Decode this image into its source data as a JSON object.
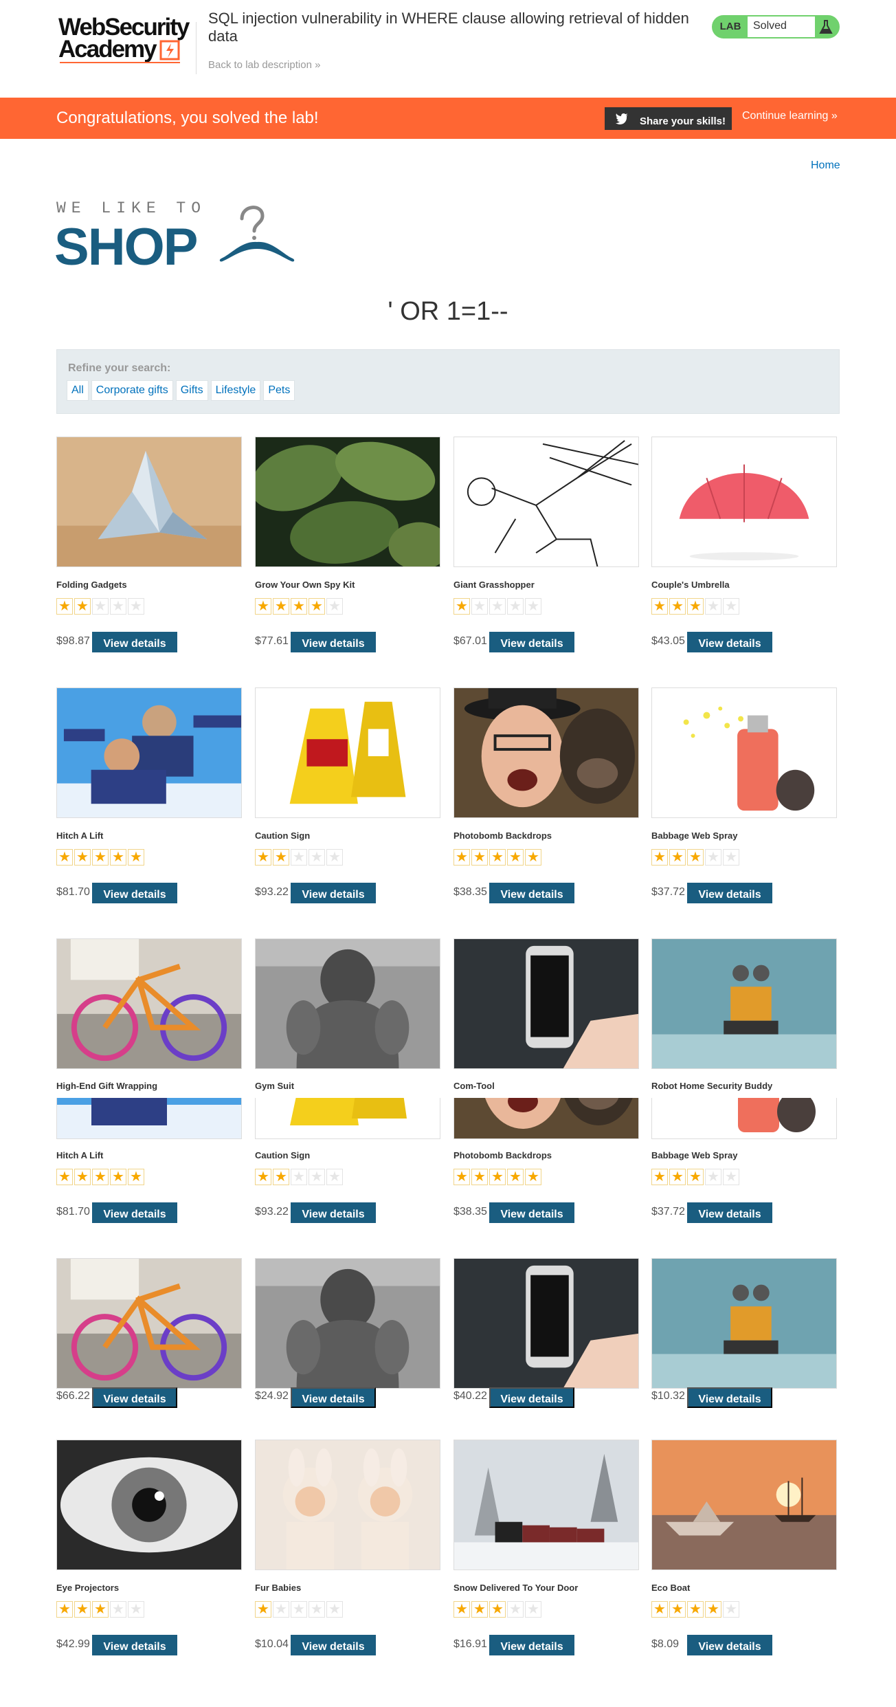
{
  "header": {
    "logo_line1": "WebSecurity",
    "logo_line2": "Academy",
    "lab_title": "SQL injection vulnerability in WHERE clause allowing retrieval of hidden data",
    "back_link": "Back to lab description  »",
    "status_label": "LAB",
    "status_value": "Solved"
  },
  "banner": {
    "message": "Congratulations, you solved the lab!",
    "share_label": "Share your skills!",
    "continue_label": "Continue learning »"
  },
  "nav": {
    "home": "Home"
  },
  "shop_logo": {
    "tagline": "WE LIKE TO",
    "word": "SHOP"
  },
  "search_title": "' OR 1=1--",
  "filter": {
    "label": "Refine your search:",
    "categories": [
      "All",
      "Corporate gifts",
      "Gifts",
      "Lifestyle",
      "Pets"
    ]
  },
  "view_details_label": "View details",
  "products": [
    {
      "name": "Folding Gadgets",
      "rating": 2,
      "price": "$98.87",
      "image": "paper-bird"
    },
    {
      "name": "Grow Your Own Spy Kit",
      "rating": 4,
      "price": "$77.61",
      "image": "leaves"
    },
    {
      "name": "Giant Grasshopper",
      "rating": 1,
      "price": "$67.01",
      "image": "sketch"
    },
    {
      "name": "Couple's Umbrella",
      "rating": 3,
      "price": "$43.05",
      "image": "umbrella"
    },
    {
      "name": "Hitch A Lift",
      "rating": 5,
      "price": "$81.70",
      "image": "skydivers"
    },
    {
      "name": "Caution Sign",
      "rating": 2,
      "price": "$93.22",
      "image": "caution-signs"
    },
    {
      "name": "Photobomb Backdrops",
      "rating": 5,
      "price": "$38.35",
      "image": "man-and-monkey"
    },
    {
      "name": "Babbage Web Spray",
      "rating": 3,
      "price": "$37.72",
      "image": "spray-can"
    },
    {
      "name": "High-End Gift Wrapping",
      "price": "$66.22",
      "image": "knitted-bike"
    },
    {
      "name": "Gym Suit",
      "price": "$24.92",
      "image": "dog-bodybuilder"
    },
    {
      "name": "Com-Tool",
      "price": "$40.22",
      "image": "phone-in-hand"
    },
    {
      "name": "Robot Home Security Buddy",
      "price": "$10.32",
      "image": "robot-toy"
    },
    {
      "name": "Eye Projectors",
      "rating": 3,
      "price": "$42.99",
      "image": "eye"
    },
    {
      "name": "Fur Babies",
      "rating": 1,
      "price": "$10.04",
      "image": "babies"
    },
    {
      "name": "Snow Delivered To Your Door",
      "rating": 3,
      "price": "$16.91",
      "image": "snow-train"
    },
    {
      "name": "Eco Boat",
      "rating": 4,
      "price": "$8.09",
      "image": "paper-boat"
    }
  ]
}
